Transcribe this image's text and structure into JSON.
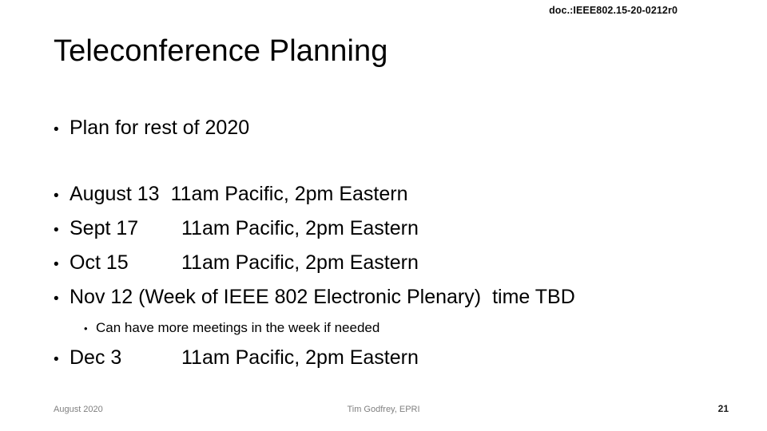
{
  "header": {
    "doc_id": "doc.:IEEE802.15-20-0212r0"
  },
  "title": "Teleconference Planning",
  "body": {
    "intro_bullet": {
      "bullet_glyph": "•",
      "text": "Plan for rest of 2020"
    },
    "schedule_bullets": [
      {
        "bullet_glyph": "•",
        "date": "August 13",
        "time": "11am Pacific, 2pm Eastern",
        "tight": true
      },
      {
        "bullet_glyph": "•",
        "date": "Sept 17",
        "time": "11am Pacific, 2pm Eastern",
        "tight": false
      },
      {
        "bullet_glyph": "•",
        "date": "Oct 15",
        "time": "11am Pacific, 2pm Eastern",
        "tight": false
      },
      {
        "bullet_glyph": "•",
        "date": "Nov 12  (Week of IEEE 802 Electronic Plenary)",
        "time": "time TBD",
        "tight": true
      }
    ],
    "sub_bullet": {
      "bullet_glyph": "•",
      "text": "Can have more meetings in the week if needed"
    },
    "final_bullet": {
      "bullet_glyph": "•",
      "date": "Dec 3",
      "time": "11am Pacific, 2pm Eastern",
      "tight": false
    }
  },
  "footer": {
    "left": "August 2020",
    "center": "Tim Godfrey, EPRI",
    "page_number": "21"
  },
  "colors": {
    "text": "#000000",
    "footer_text": "#808080",
    "background": "#ffffff"
  }
}
